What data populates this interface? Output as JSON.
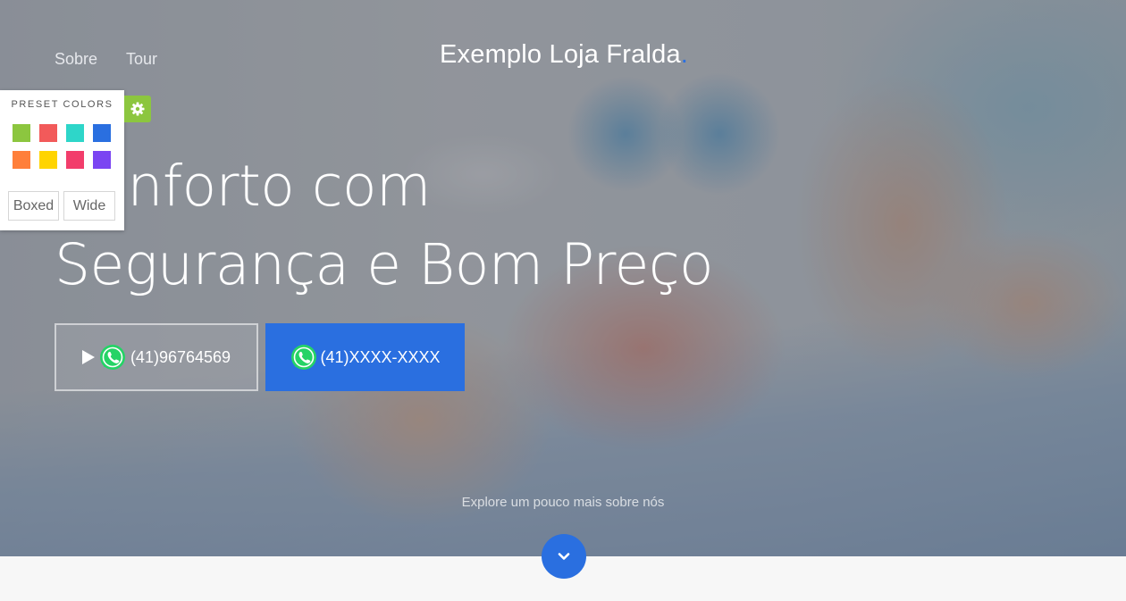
{
  "nav": {
    "links": [
      "Sobre",
      "Tour"
    ],
    "brand": "Exemplo Loja Fralda",
    "brand_dot": "."
  },
  "hero": {
    "headline_line1": "Conforto com",
    "headline_line2": "Segurança e Bom Preço",
    "cta_primary_phone": "(41)96764569",
    "cta_secondary_phone": "(41)XXXX-XXXX",
    "explore_text": "Explore um pouco mais sobre nós"
  },
  "preset_panel": {
    "title": "PRESET COLORS",
    "colors": [
      "#8cc63f",
      "#f25a5a",
      "#2ed6c9",
      "#2a6fe0",
      "#ff7f3a",
      "#ffd400",
      "#f23d6b",
      "#7b45f2"
    ],
    "boxed_label": "Boxed",
    "wide_label": "Wide"
  },
  "icons": {
    "gear": "gear-icon",
    "play": "play-icon",
    "whatsapp": "whatsapp-icon",
    "chevron_down": "chevron-down-icon"
  },
  "colors": {
    "accent": "#2a6fe0",
    "toggle": "#8cc63f",
    "whatsapp": "#25d366"
  }
}
